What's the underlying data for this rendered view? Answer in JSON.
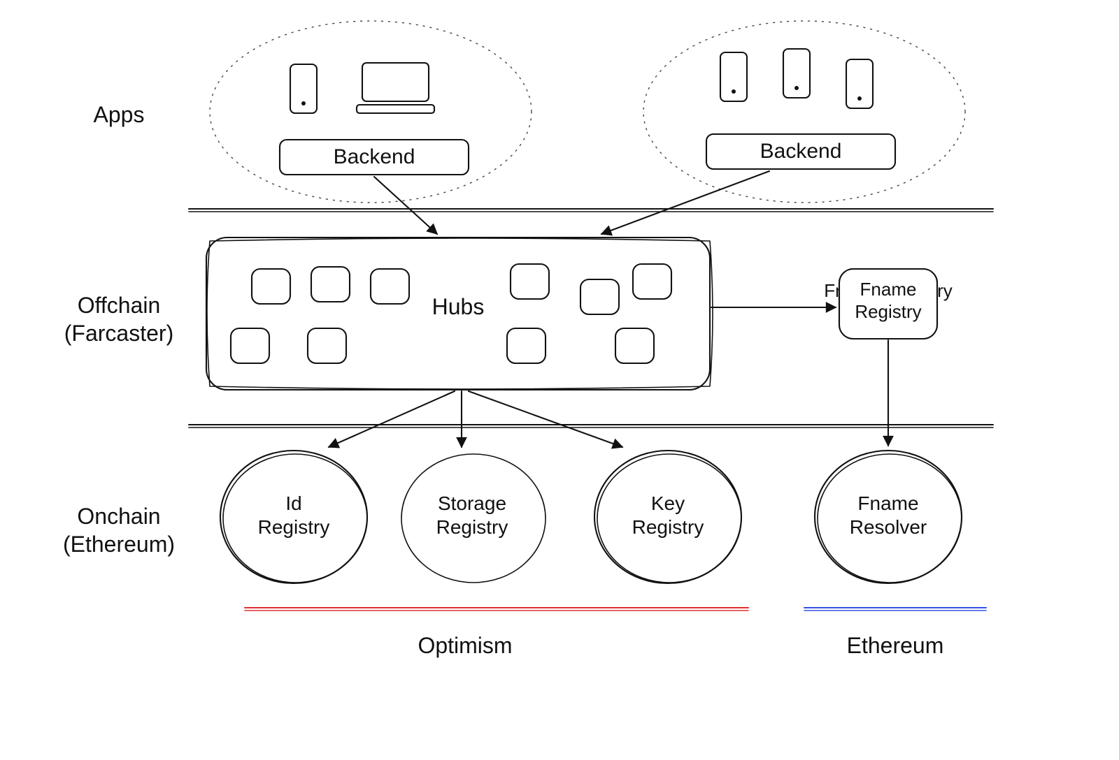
{
  "rows": {
    "apps_label": "Apps",
    "offchain_label_line1": "Offchain",
    "offchain_label_line2": "(Farcaster)",
    "onchain_label_line1": "Onchain",
    "onchain_label_line2": "(Ethereum)"
  },
  "apps": {
    "backend_left": "Backend",
    "backend_right": "Backend"
  },
  "hubs": {
    "title": "Hubs"
  },
  "fname_registry": "Fname\nRegistry",
  "contracts": {
    "id_registry": "Id\nRegistry",
    "storage_registry": "Storage\nRegistry",
    "key_registry": "Key\nRegistry",
    "fname_resolver": "Fname\nResolver"
  },
  "chains": {
    "optimism": "Optimism",
    "ethereum": "Ethereum"
  },
  "colors": {
    "optimism_line": "#e03030",
    "ethereum_line": "#3050e0"
  }
}
